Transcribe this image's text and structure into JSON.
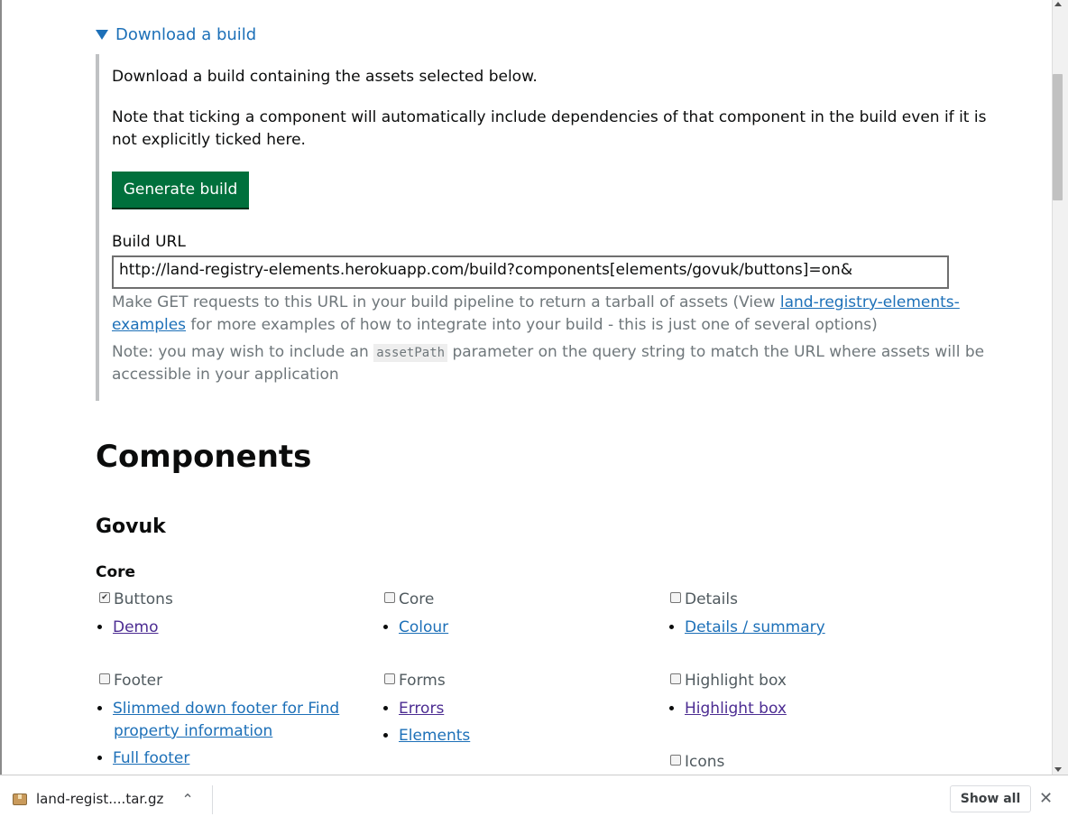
{
  "details": {
    "summary": "Download a build",
    "intro": "Download a build containing the assets selected below.",
    "note_line1": "Note that ticking a component will automatically include dependencies of that component in the build even if it is",
    "note_line2": "not explicitly ticked here.",
    "generate_button": "Generate build",
    "build_url_label": "Build URL",
    "build_url_value": "http://land-registry-elements.herokuapp.com/build?components[elements/govuk/buttons]=on&",
    "hint1_pre": "Make GET requests to this URL in your build pipeline to return a tarball of assets (View ",
    "hint1_link_a": "land-registry-elements-",
    "hint1_link_b": "examples",
    "hint1_post": " for more examples of how to integrate into your build - this is just one of several options)",
    "hint2_pre": "Note: you may wish to include an ",
    "hint2_code": "assetPath",
    "hint2_post_a": " parameter on the query string to match the URL where assets will be",
    "hint2_post_b": "accessible in your application"
  },
  "components": {
    "heading": "Components",
    "group": "Govuk",
    "subgroup": "Core",
    "items": [
      {
        "label": "Buttons",
        "checked": true,
        "links": [
          "Demo"
        ]
      },
      {
        "label": "Core",
        "checked": false,
        "links": [
          "Colour"
        ]
      },
      {
        "label": "Details",
        "checked": false,
        "links": [
          "Details / summary"
        ]
      },
      {
        "label": "Footer",
        "checked": false,
        "links": [
          "Slimmed down footer for Find",
          "property information",
          "Full footer"
        ]
      },
      {
        "label": "Forms",
        "checked": false,
        "links": [
          "Errors",
          "Elements"
        ]
      },
      {
        "label": "Highlight box",
        "checked": false,
        "links": [
          "Highlight box"
        ]
      },
      {
        "label": "Icons",
        "checked": false,
        "links": []
      }
    ]
  },
  "download_bar": {
    "file_name": "land-regist....tar.gz",
    "chevron": "⌃",
    "show_all": "Show all",
    "close": "✕"
  }
}
